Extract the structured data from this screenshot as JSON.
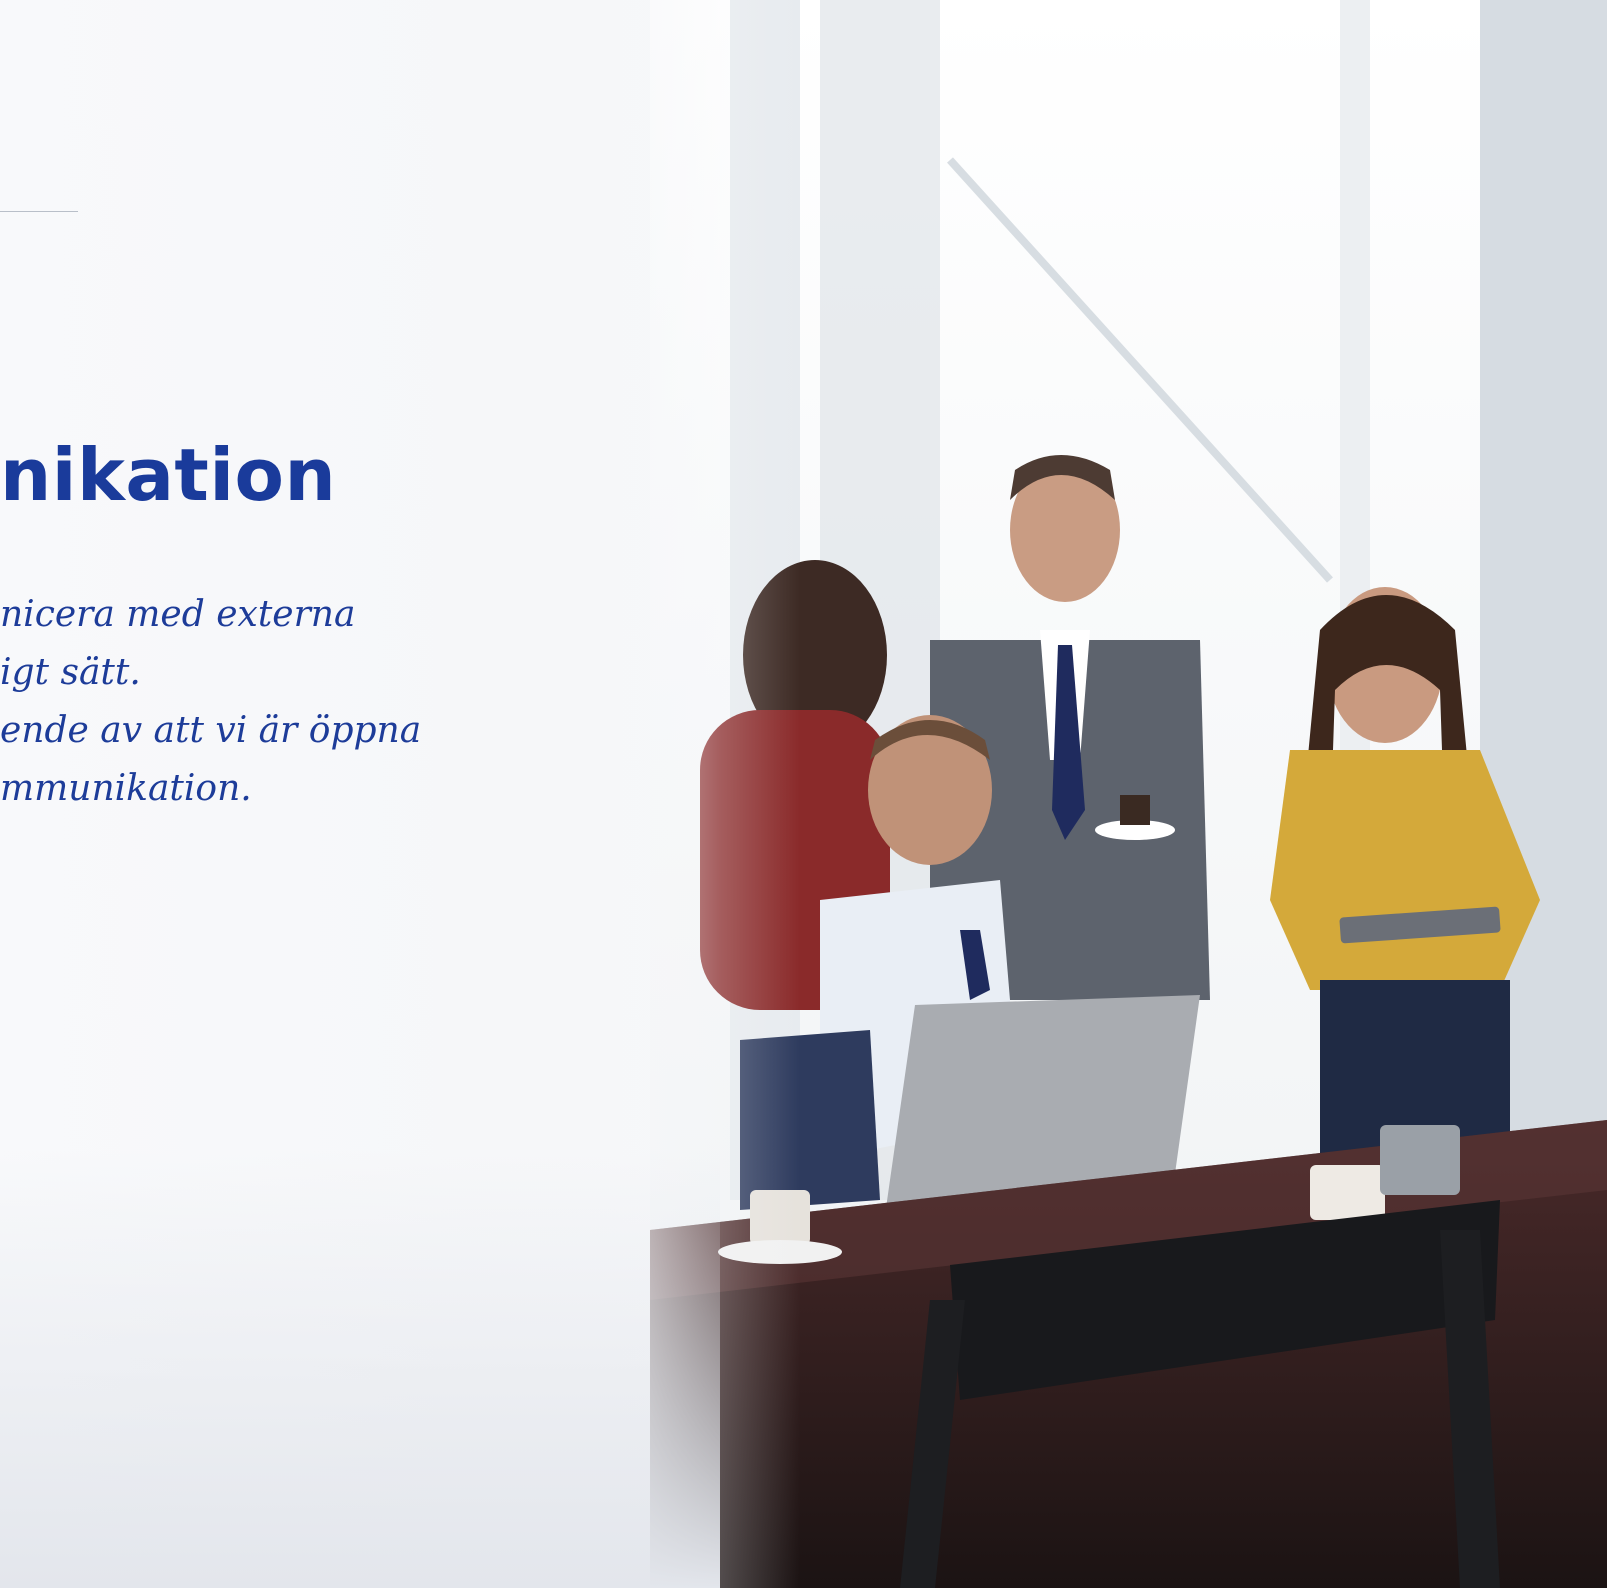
{
  "heading": "nikation",
  "body_lines": [
    "nicera med externa",
    "igt sätt.",
    "ende av att vi är öppna",
    "mmunikation."
  ],
  "colors": {
    "heading": "#1a3b9b",
    "body_text": "#1d3c99",
    "background": "#f7f8fa"
  }
}
